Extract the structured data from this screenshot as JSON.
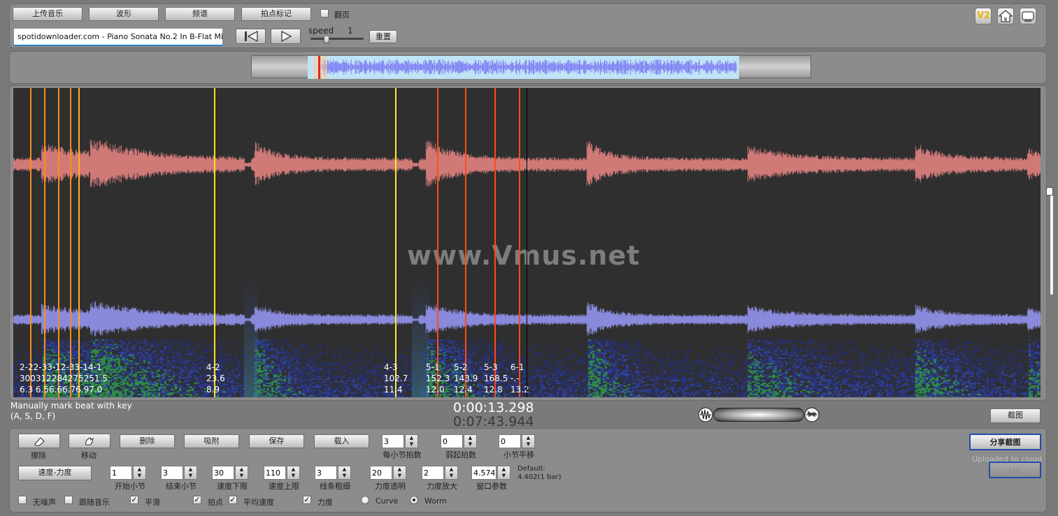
{
  "toolbar": {
    "upload_label": "上传音乐",
    "waveform_label": "波形",
    "spectrum_label": "频谱",
    "beat_mark_label": "拍点标记",
    "flip_page_label": "翻页",
    "v2_label": "V2",
    "track_title": "spotidownloader.com - Piano Sonata No.2 In B-Flat Minor, C",
    "speed_label": "speed",
    "speed_value": "1",
    "reset_label": "重置"
  },
  "overview": {
    "viewport_start_fraction": 0.1,
    "viewport_end_fraction": 0.87
  },
  "markers": [
    {
      "id": "2-2",
      "tempo": "300",
      "strength": "6.3",
      "color": "#ff8c1a"
    },
    {
      "id": "2-3",
      "tempo": "312",
      "strength": "6.5",
      "color": "#ff8c1a"
    },
    {
      "id": "3-1",
      "tempo": "284",
      "strength": "6.6",
      "color": "#ff8c1a"
    },
    {
      "id": "2-3",
      "tempo": "275",
      "strength": "6.7",
      "color": "#ff8c1a"
    },
    {
      "id": "3-1",
      "tempo": "251",
      "strength": "6.9",
      "color": "#ff9a22"
    },
    {
      "id": "4-1",
      "tempo": "91.5",
      "strength": "7.0",
      "color": "#ffb020"
    },
    {
      "id": "4-2",
      "tempo": "23.6",
      "strength": "8.9",
      "color": "#ffe11a"
    },
    {
      "id": "4-3",
      "tempo": "102.7",
      "strength": "11.4",
      "color": "#ffee22"
    },
    {
      "id": "5-1",
      "tempo": "152.3",
      "strength": "12.0",
      "color": "#ff4a1a"
    },
    {
      "id": "5-2",
      "tempo": "143.9",
      "strength": "12.4",
      "color": "#ff4a1a"
    },
    {
      "id": "5-3",
      "tempo": "168.5",
      "strength": "12.8",
      "color": "#ff4a1a"
    },
    {
      "id": "6-1",
      "tempo": "-.-",
      "strength": "13.2",
      "color": "#ff4a1a"
    }
  ],
  "overlay_labels": {
    "row1": "2-22-33-12-33-14-1",
    "row2": "300312284275251.5",
    "row3": "6.3 6.56.66.76.97.0"
  },
  "watermark": "www.Vmus.net",
  "status": {
    "hint": "Manually mark beat with key",
    "keys": "(A, S, D, F)",
    "current_time": "0:00:13.298",
    "total_time": "0:07:43.944"
  },
  "right_panel": {
    "screenshot_label": "截图",
    "share_label": "分享截图",
    "uploaded_label": "Uploaded to cloud",
    "url_label": "Url"
  },
  "tools": {
    "erase_label": "擦除",
    "move_label": "移动",
    "delete_label": "删除",
    "snap_label": "吸附",
    "save_label": "保存",
    "load_label": "载入",
    "tempo_dynamic_label": "速度-力度"
  },
  "spinners": [
    {
      "key": "beats_per_bar",
      "label": "每小节拍数",
      "value": "3"
    },
    {
      "key": "upbeat_beats",
      "label": "弱起拍数",
      "value": "0"
    },
    {
      "key": "bar_shift",
      "label": "小节平移",
      "value": "0"
    },
    {
      "key": "start_bar",
      "label": "开始小节",
      "value": "1"
    },
    {
      "key": "end_bar",
      "label": "结束小节",
      "value": "3"
    },
    {
      "key": "tempo_lower",
      "label": "速度下限",
      "value": "30"
    },
    {
      "key": "tempo_upper",
      "label": "速度上限",
      "value": "110"
    },
    {
      "key": "line_width",
      "label": "线条粗细",
      "value": "3"
    },
    {
      "key": "dynamic_opacity",
      "label": "力度透明",
      "value": "20"
    },
    {
      "key": "dynamic_zoom",
      "label": "力度放大",
      "value": "2"
    },
    {
      "key": "window_param",
      "label": "窗口参数",
      "value": "4.5747"
    }
  ],
  "defaults": {
    "label": "Default:",
    "value": "4.402(1 bar)"
  },
  "options": {
    "no_noise": {
      "label": "无噪声",
      "checked": false
    },
    "follow_music": {
      "label": "跟随音乐",
      "checked": false
    },
    "smooth": {
      "label": "平滑",
      "checked": true
    },
    "beats": {
      "label": "拍点",
      "checked": true
    },
    "avg_tempo": {
      "label": "平均速度",
      "checked": true
    },
    "dynamics": {
      "label": "力度",
      "checked": true
    },
    "curve": {
      "label": "Curve",
      "selected": false
    },
    "worm": {
      "label": "Worm",
      "selected": true
    }
  },
  "colors": {
    "upper_wave": "#d07a78",
    "lower_wave": "#8a8adc",
    "overview_bg": "#bfe4f7",
    "overview_wave": "#7f7cf2",
    "playhead": "#000000"
  }
}
